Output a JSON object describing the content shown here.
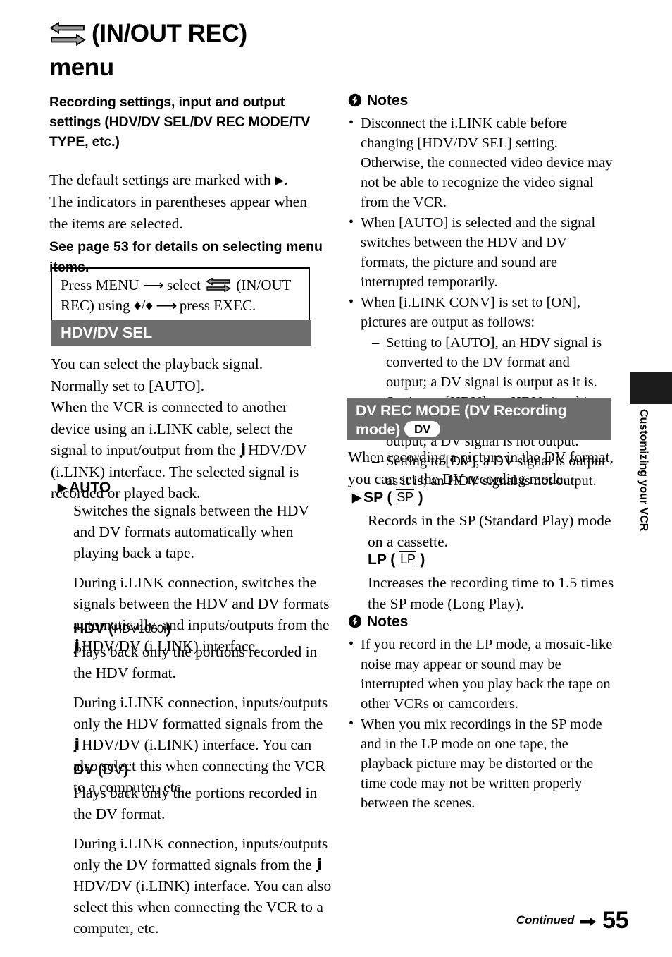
{
  "title": {
    "icon": "two-way-arrows-icon",
    "line1": "(IN/OUT REC)",
    "line2": "menu"
  },
  "subtitle": "Recording settings, input and output settings (HDV/DV SEL/DV REC MODE/TV TYPE, etc.)",
  "intro": {
    "line1_a": "The default settings are marked with ",
    "line1_tri": "▶",
    "line1_b": ".",
    "line2": "The indicators in parentheses appear when",
    "line3": "the items are selected.",
    "bold": "See page 53 for details on selecting menu items."
  },
  "menu_box": {
    "part1": "Press MENU ",
    "arrow1": "⟶",
    "part2": " select ",
    "icon": "two-way-arrows-icon",
    "part3": " (IN/OUT REC) using ",
    "updown": "♦/♦",
    "arrow2": " ⟶ ",
    "part4": "press EXEC."
  },
  "sections": {
    "hdv_dv_sel": {
      "heading": "HDV/DV SEL",
      "description": "You can select the playback signal. Normally set to [AUTO]. When the VCR is connected to another device using an i.LINK cable, select the signal to input/output from the ıHDV/DV (i.LINK) interface. The selected signal is recorded or played back.",
      "desc_lines": [
        "You can select the playback signal.",
        "Normally set to [AUTO].",
        "When the VCR is connected to another",
        "device using an i.LINK cable, select the",
        "signal to input/output from the",
        "HDV/DV",
        "(i.LINK) interface. The selected signal is",
        "recorded or played back."
      ],
      "options": [
        {
          "default_marker": "▶",
          "name": "AUTO",
          "badge": "",
          "paragraphs": [
            "Switches the signals between the HDV and DV formats automatically when playing back a tape.",
            "During i.LINK connection, switches the signals between the HDV and DV formats automatically, and inputs/outputs from the ıHDV/DV (i.LINK) interface."
          ]
        },
        {
          "default_marker": "",
          "name": "HDV",
          "badge": "HDV1080i",
          "paragraphs": [
            "Plays back only the portions recorded in the HDV format.",
            "During i.LINK connection, inputs/outputs only the HDV formatted signals from the ıHDV/DV (i.LINK) interface. You can also select this when connecting the VCR to a computer, etc."
          ]
        },
        {
          "default_marker": "",
          "name": "DV",
          "badge": "DV",
          "paragraphs": [
            "Plays back only the portions recorded in the DV format.",
            "During i.LINK connection, inputs/outputs only the DV formatted signals from the ıHDV/DV (i.LINK) interface. You can also select this when connecting the VCR to a computer, etc."
          ]
        }
      ]
    },
    "dv_rec_mode": {
      "heading_line1": "DV REC MODE (DV Recording",
      "heading_line2": "mode)",
      "heading_pill": "DV",
      "description": "When recording a picture in the DV format, you can set the DV recording mode.",
      "options": [
        {
          "default_marker": "▶",
          "name": "SP",
          "badge": "SP",
          "paragraphs": [
            "Records in the SP (Standard Play) mode on a cassette."
          ]
        },
        {
          "default_marker": "",
          "name": "LP",
          "badge": "LP",
          "paragraphs": [
            "Increases the recording time to 1.5 times the SP mode (Long Play)."
          ]
        }
      ]
    }
  },
  "notes_1": {
    "heading": "Notes",
    "icon": "note-bolt-icon",
    "items": [
      {
        "text": "Disconnect the i.LINK cable before changing [HDV/DV SEL] setting. Otherwise, the connected video device may not be able to recognize the video signal from the VCR.",
        "sub": []
      },
      {
        "text": "When [AUTO] is selected and the signal switches between the HDV and DV formats, the picture and sound are interrupted temporarily.",
        "sub": []
      },
      {
        "text": "When [i.LINK CONV] is set to [ON], pictures are output as follows:",
        "sub": [
          "Setting to [AUTO], an HDV signal is converted to the DV format and output; a DV signal is output as it is.",
          "Setting to [HDV], an HDV signal is converted to the DV format and output; a DV signal is not output.",
          "Setting to [DV], a DV signal is output as it is; an HDV signal is not output."
        ]
      }
    ]
  },
  "notes_2": {
    "heading": "Notes",
    "icon": "note-bolt-icon",
    "items": [
      {
        "text": "If you record in the LP mode, a mosaic-like noise may appear or sound may be interrupted when you play back the tape on other VCRs or camcorders.",
        "sub": []
      },
      {
        "text": "When you mix recordings in the SP mode and in the LP mode on one tape, the playback picture may be distorted or the time code may not be written properly between the scenes.",
        "sub": []
      }
    ]
  },
  "side_tab": {
    "label": "Customizing your VCR"
  },
  "footer": {
    "continued": "Continued",
    "arrow": "➜",
    "page_number": "55"
  },
  "colors": {
    "section_header_bg": "#6d6d6d",
    "section_header_text": "#ffffff",
    "side_tab_bg": "#1c1c1c",
    "arrow_icon_fill": "#9a9a9a",
    "page_bg": "#ffffff"
  }
}
